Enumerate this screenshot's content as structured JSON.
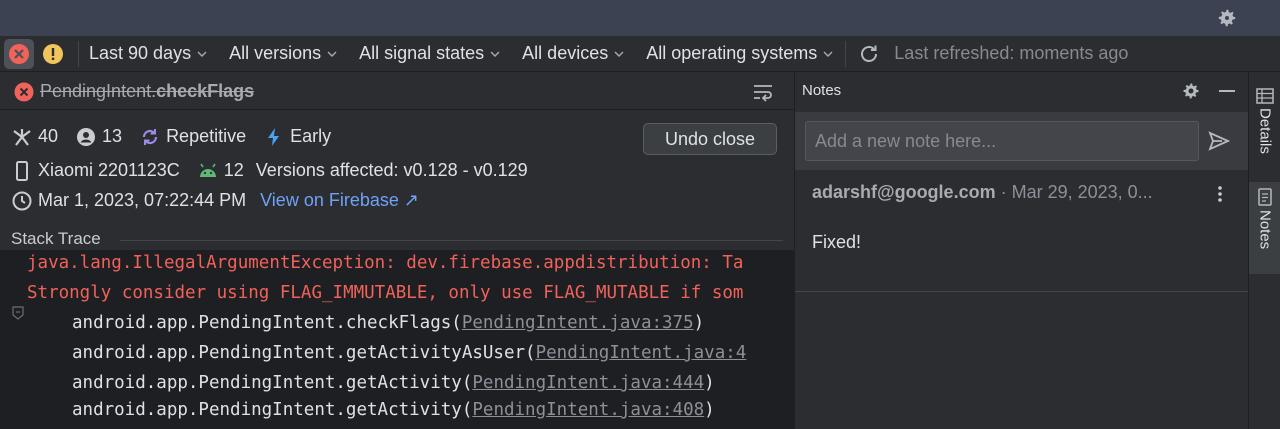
{
  "toolbar": {
    "filters": [
      "Last 90 days",
      "All versions",
      "All signal states",
      "All devices",
      "All operating systems"
    ],
    "last_refreshed": "Last refreshed: moments ago"
  },
  "issue": {
    "class_name": "PendingIntent.",
    "method_name": "checkFlags",
    "events": "40",
    "users": "13",
    "signal_repetitive": "Repetitive",
    "signal_early": "Early",
    "undo_label": "Undo close",
    "device": "Xiaomi 2201123C",
    "android_version": "12",
    "versions_affected": "Versions affected: v0.128 - v0.129",
    "timestamp": "Mar 1, 2023, 07:22:44 PM",
    "firebase_link": "View on Firebase ↗"
  },
  "stack": {
    "label": "Stack Trace",
    "exception_line1": "java.lang.IllegalArgumentException: dev.firebase.appdistribution: Ta",
    "exception_line2": "Strongly consider using FLAG_IMMUTABLE, only use FLAG_MUTABLE if som",
    "frames": [
      {
        "method": "android.app.PendingIntent.checkFlags(",
        "source": "PendingIntent.java:375",
        "end": ")"
      },
      {
        "method": "android.app.PendingIntent.getActivityAsUser(",
        "source": "PendingIntent.java:4",
        "end": ""
      },
      {
        "method": "android.app.PendingIntent.getActivity(",
        "source": "PendingIntent.java:444",
        "end": ")"
      },
      {
        "method": "android.app.PendingIntent.getActivity(",
        "source": "PendingIntent.java:408",
        "end": ")"
      }
    ]
  },
  "notes": {
    "title": "Notes",
    "placeholder": "Add a new note here...",
    "items": [
      {
        "author": "adarshf@google.com",
        "date": " · Mar 29, 2023, 0...",
        "text": "Fixed!"
      }
    ]
  },
  "side_tabs": [
    "Details",
    "Notes"
  ],
  "colors": {
    "error_red": "#f0625a",
    "link_blue": "#6ea2f7",
    "warning_yellow": "#f2c55c",
    "android_green": "#5fb877",
    "signal_purple": "#9b8ae8"
  }
}
